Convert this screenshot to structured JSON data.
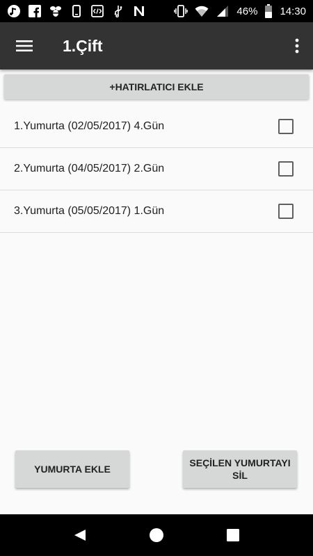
{
  "status_bar": {
    "left_icons": [
      "music-app-icon",
      "facebook-icon",
      "bee-app-icon",
      "phone-device-icon",
      "code-app-icon",
      "usb-icon",
      "n-app-icon"
    ],
    "right_icons": [
      "vibrate-icon",
      "wifi-icon",
      "signal-icon",
      "battery-icon"
    ],
    "battery_percent": "46%",
    "time": "14:30"
  },
  "app_bar": {
    "title": "1.Çift",
    "menu_icon": "hamburger-menu-icon",
    "overflow_icon": "more-vert-icon",
    "background": "#333333"
  },
  "main": {
    "add_reminder_label": "+HATIRLATICI EKLE",
    "eggs": [
      {
        "label": "1.Yumurta (02/05/2017) 4.Gün",
        "checked": false
      },
      {
        "label": "2.Yumurta (04/05/2017) 2.Gün",
        "checked": false
      },
      {
        "label": "3.Yumurta (05/05/2017) 1.Gün",
        "checked": false
      }
    ],
    "add_egg_label": "YUMURTA EKLE",
    "delete_selected_label": "SEÇİLEN YUMURTAYI SİL"
  },
  "nav_bar": {
    "buttons": [
      "back-icon",
      "home-icon",
      "recents-icon"
    ]
  }
}
